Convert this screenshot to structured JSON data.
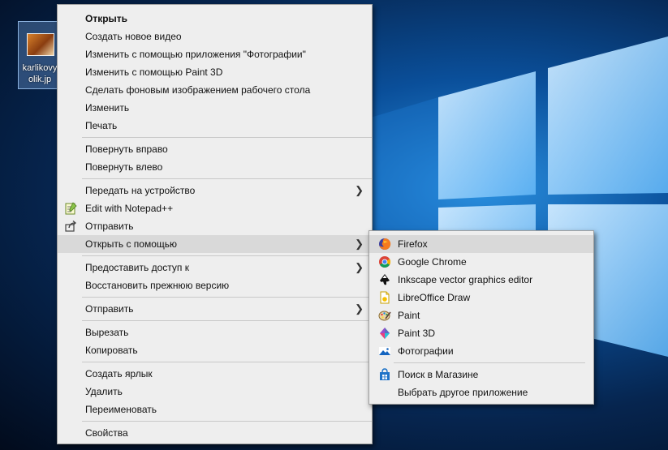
{
  "desktop": {
    "icon_label": "karlikovy\nolik.jp"
  },
  "context_menu": {
    "open": "Открыть",
    "create_video": "Создать новое видео",
    "edit_photos": "Изменить с помощью приложения \"Фотографии\"",
    "edit_paint3d": "Изменить с помощью Paint 3D",
    "set_wallpaper": "Сделать фоновым изображением рабочего стола",
    "edit": "Изменить",
    "print": "Печать",
    "rotate_right": "Повернуть вправо",
    "rotate_left": "Повернуть влево",
    "cast_to_device": "Передать на устройство",
    "edit_notepadpp": "Edit with Notepad++",
    "share": "Отправить",
    "open_with": "Открыть с помощью",
    "give_access": "Предоставить доступ к",
    "restore_versions": "Восстановить прежнюю версию",
    "send_to": "Отправить",
    "cut": "Вырезать",
    "copy": "Копировать",
    "create_shortcut": "Создать ярлык",
    "delete": "Удалить",
    "rename": "Переименовать",
    "properties": "Свойства"
  },
  "open_with_menu": {
    "apps": [
      {
        "label": "Firefox",
        "icon": "firefox-icon"
      },
      {
        "label": "Google Chrome",
        "icon": "chrome-icon"
      },
      {
        "label": "Inkscape vector graphics editor",
        "icon": "inkscape-icon"
      },
      {
        "label": "LibreOffice Draw",
        "icon": "libreoffice-draw-icon"
      },
      {
        "label": "Paint",
        "icon": "paint-icon"
      },
      {
        "label": "Paint 3D",
        "icon": "paint3d-icon"
      },
      {
        "label": "Фотографии",
        "icon": "photos-icon"
      }
    ],
    "search_store": "Поиск в Магазине",
    "choose_other": "Выбрать другое приложение"
  },
  "colors": {
    "menu_bg": "#eeeeee",
    "menu_highlight": "#d9d9d9",
    "desktop_blue": "#0a4f9a"
  }
}
